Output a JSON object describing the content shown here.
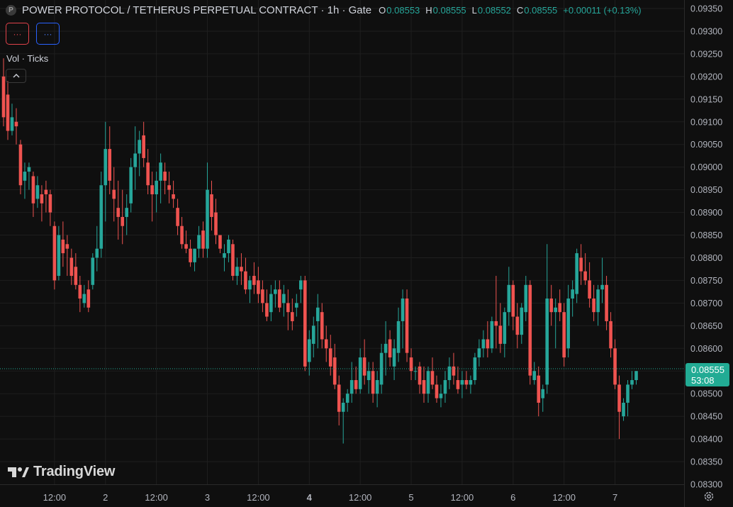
{
  "legend": {
    "logo_letter": "P",
    "title": "POWER PROTOCOL / TETHERUS PERPETUAL CONTRACT · 1h · Gate",
    "open_label": "O",
    "open": "0.08553",
    "high_label": "H",
    "high": "0.08555",
    "low_label": "L",
    "low": "0.08552",
    "close_label": "C",
    "close": "0.08555",
    "change": "+0.00011 (+0.13%)"
  },
  "indicator_buttons": [
    "···",
    "···"
  ],
  "volume_label": "Vol · Ticks",
  "brand": "TradingView",
  "last_price": {
    "price": "0.08555",
    "countdown": "53:08"
  },
  "colors": {
    "up": "#26a69a",
    "down": "#ef5350",
    "background": "#0f0f0f",
    "grid": "#1f1f1f",
    "tag": "#22ab94"
  },
  "chart_data": {
    "type": "candlestick",
    "y_ticks": [
      "0.09350",
      "0.09300",
      "0.09250",
      "0.09200",
      "0.09150",
      "0.09100",
      "0.09050",
      "0.09000",
      "0.08950",
      "0.08900",
      "0.08850",
      "0.08800",
      "0.08750",
      "0.08700",
      "0.08650",
      "0.08600",
      "0.08550",
      "0.08500",
      "0.08450",
      "0.08400",
      "0.08350",
      "0.08300"
    ],
    "ylim": [
      0.083,
      0.0935
    ],
    "x_ticks": [
      {
        "label": "12:00",
        "hour": 12,
        "bold": false
      },
      {
        "label": "2",
        "hour": 24,
        "bold": false
      },
      {
        "label": "12:00",
        "hour": 36,
        "bold": false
      },
      {
        "label": "3",
        "hour": 48,
        "bold": false
      },
      {
        "label": "12:00",
        "hour": 60,
        "bold": false
      },
      {
        "label": "4",
        "hour": 72,
        "bold": true
      },
      {
        "label": "12:00",
        "hour": 84,
        "bold": false
      },
      {
        "label": "5",
        "hour": 96,
        "bold": false
      },
      {
        "label": "12:00",
        "hour": 108,
        "bold": false
      },
      {
        "label": "6",
        "hour": 120,
        "bold": false
      },
      {
        "label": "12:00",
        "hour": 132,
        "bold": false
      },
      {
        "label": "7",
        "hour": 144,
        "bold": false
      }
    ],
    "ohlc": [
      [
        0.092,
        0.0924,
        0.0909,
        0.0911
      ],
      [
        0.0916,
        0.0919,
        0.0906,
        0.0908
      ],
      [
        0.0908,
        0.0914,
        0.0907,
        0.0911
      ],
      [
        0.091,
        0.0913,
        0.0905,
        0.0909
      ],
      [
        0.0905,
        0.0906,
        0.0894,
        0.0896
      ],
      [
        0.0897,
        0.0901,
        0.0893,
        0.0899
      ],
      [
        0.0899,
        0.0901,
        0.0895,
        0.09
      ],
      [
        0.0898,
        0.0899,
        0.0889,
        0.0892
      ],
      [
        0.0893,
        0.0898,
        0.0891,
        0.0896
      ],
      [
        0.0894,
        0.0896,
        0.0888,
        0.0892
      ],
      [
        0.0895,
        0.0897,
        0.089,
        0.0894
      ],
      [
        0.0894,
        0.0895,
        0.0887,
        0.089
      ],
      [
        0.0887,
        0.0888,
        0.0873,
        0.0875
      ],
      [
        0.0876,
        0.0887,
        0.0875,
        0.0885
      ],
      [
        0.0884,
        0.0888,
        0.0878,
        0.0881
      ],
      [
        0.0883,
        0.0885,
        0.0876,
        0.0882
      ],
      [
        0.088,
        0.0882,
        0.0874,
        0.0876
      ],
      [
        0.0878,
        0.0881,
        0.0873,
        0.0874
      ],
      [
        0.0874,
        0.0876,
        0.0868,
        0.0871
      ],
      [
        0.087,
        0.0874,
        0.0869,
        0.0872
      ],
      [
        0.0873,
        0.0875,
        0.0868,
        0.0869
      ],
      [
        0.0874,
        0.0881,
        0.0873,
        0.088
      ],
      [
        0.088,
        0.0887,
        0.0877,
        0.0882
      ],
      [
        0.0882,
        0.0899,
        0.088,
        0.0896
      ],
      [
        0.0896,
        0.091,
        0.0888,
        0.0904
      ],
      [
        0.0904,
        0.0909,
        0.0894,
        0.0897
      ],
      [
        0.0895,
        0.09,
        0.0888,
        0.0893
      ],
      [
        0.0891,
        0.0897,
        0.0884,
        0.0889
      ],
      [
        0.0889,
        0.0895,
        0.0883,
        0.0887
      ],
      [
        0.0889,
        0.0894,
        0.0885,
        0.0891
      ],
      [
        0.0892,
        0.0902,
        0.089,
        0.09
      ],
      [
        0.09,
        0.0909,
        0.0895,
        0.0903
      ],
      [
        0.0903,
        0.0908,
        0.0898,
        0.0906
      ],
      [
        0.0907,
        0.091,
        0.09,
        0.0902
      ],
      [
        0.0901,
        0.0904,
        0.0894,
        0.0896
      ],
      [
        0.0896,
        0.0899,
        0.0888,
        0.0894
      ],
      [
        0.0894,
        0.0899,
        0.089,
        0.0897
      ],
      [
        0.0897,
        0.0903,
        0.0892,
        0.0901
      ],
      [
        0.0899,
        0.0901,
        0.0894,
        0.0897
      ],
      [
        0.0896,
        0.0899,
        0.0892,
        0.0895
      ],
      [
        0.0894,
        0.0897,
        0.0891,
        0.0893
      ],
      [
        0.0891,
        0.0893,
        0.0885,
        0.0887
      ],
      [
        0.0887,
        0.0889,
        0.0882,
        0.0883
      ],
      [
        0.0883,
        0.0886,
        0.0881,
        0.0882
      ],
      [
        0.0882,
        0.0884,
        0.0878,
        0.0879
      ],
      [
        0.0879,
        0.0882,
        0.0877,
        0.0882
      ],
      [
        0.0882,
        0.0887,
        0.088,
        0.0885
      ],
      [
        0.0886,
        0.0888,
        0.088,
        0.0882
      ],
      [
        0.0882,
        0.0901,
        0.088,
        0.0895
      ],
      [
        0.0894,
        0.0897,
        0.0886,
        0.0889
      ],
      [
        0.089,
        0.0893,
        0.0883,
        0.0885
      ],
      [
        0.0885,
        0.0884,
        0.0881,
        0.0882
      ],
      [
        0.088,
        0.0883,
        0.0877,
        0.0881
      ],
      [
        0.0881,
        0.0885,
        0.0879,
        0.0884
      ],
      [
        0.0883,
        0.0884,
        0.0875,
        0.0876
      ],
      [
        0.0876,
        0.088,
        0.0874,
        0.0878
      ],
      [
        0.0878,
        0.0881,
        0.0874,
        0.0877
      ],
      [
        0.0877,
        0.088,
        0.0872,
        0.0873
      ],
      [
        0.0873,
        0.0876,
        0.087,
        0.0875
      ],
      [
        0.0876,
        0.0879,
        0.0872,
        0.0874
      ],
      [
        0.0875,
        0.0878,
        0.087,
        0.0872
      ],
      [
        0.0873,
        0.0875,
        0.0868,
        0.087
      ],
      [
        0.087,
        0.0873,
        0.0866,
        0.0867
      ],
      [
        0.0868,
        0.0874,
        0.0866,
        0.0872
      ],
      [
        0.0872,
        0.0875,
        0.0869,
        0.0873
      ],
      [
        0.0873,
        0.0875,
        0.0868,
        0.0869
      ],
      [
        0.087,
        0.0874,
        0.0867,
        0.0872
      ],
      [
        0.087,
        0.0873,
        0.0864,
        0.0868
      ],
      [
        0.0868,
        0.0871,
        0.0864,
        0.0866
      ],
      [
        0.0869,
        0.0872,
        0.0867,
        0.087
      ],
      [
        0.0873,
        0.0876,
        0.087,
        0.0875
      ],
      [
        0.0875,
        0.0876,
        0.0855,
        0.0856
      ],
      [
        0.0857,
        0.0864,
        0.0854,
        0.0862
      ],
      [
        0.0861,
        0.0867,
        0.0858,
        0.0865
      ],
      [
        0.0866,
        0.0872,
        0.086,
        0.0869
      ],
      [
        0.0868,
        0.087,
        0.086,
        0.0862
      ],
      [
        0.0862,
        0.0865,
        0.0857,
        0.086
      ],
      [
        0.086,
        0.0863,
        0.0854,
        0.0856
      ],
      [
        0.0858,
        0.0861,
        0.0851,
        0.0852
      ],
      [
        0.0852,
        0.0854,
        0.0843,
        0.0846
      ],
      [
        0.0846,
        0.0849,
        0.0839,
        0.0848
      ],
      [
        0.0848,
        0.0851,
        0.0846,
        0.085
      ],
      [
        0.085,
        0.0857,
        0.0848,
        0.0853
      ],
      [
        0.0853,
        0.0856,
        0.085,
        0.0851
      ],
      [
        0.0851,
        0.086,
        0.085,
        0.0858
      ],
      [
        0.0858,
        0.0862,
        0.0852,
        0.0854
      ],
      [
        0.0853,
        0.0857,
        0.085,
        0.0855
      ],
      [
        0.0855,
        0.0857,
        0.0848,
        0.085
      ],
      [
        0.085,
        0.0855,
        0.0847,
        0.0853
      ],
      [
        0.0852,
        0.0861,
        0.085,
        0.0859
      ],
      [
        0.0859,
        0.0866,
        0.0854,
        0.0861
      ],
      [
        0.0862,
        0.0864,
        0.0856,
        0.0858
      ],
      [
        0.0856,
        0.0862,
        0.0853,
        0.086
      ],
      [
        0.0859,
        0.0869,
        0.0857,
        0.0866
      ],
      [
        0.0866,
        0.0873,
        0.086,
        0.0871
      ],
      [
        0.0871,
        0.0873,
        0.0857,
        0.0859
      ],
      [
        0.0858,
        0.086,
        0.0853,
        0.0855
      ],
      [
        0.0855,
        0.0856,
        0.0853,
        0.0855
      ],
      [
        0.0856,
        0.0857,
        0.085,
        0.0852
      ],
      [
        0.0853,
        0.0856,
        0.0848,
        0.085
      ],
      [
        0.085,
        0.0856,
        0.0848,
        0.0855
      ],
      [
        0.0855,
        0.0858,
        0.0851,
        0.0852
      ],
      [
        0.0852,
        0.0854,
        0.0848,
        0.0849
      ],
      [
        0.0849,
        0.0852,
        0.0847,
        0.085
      ],
      [
        0.085,
        0.0855,
        0.0848,
        0.0853
      ],
      [
        0.0853,
        0.0858,
        0.0851,
        0.0856
      ],
      [
        0.0856,
        0.0859,
        0.0852,
        0.0854
      ],
      [
        0.0853,
        0.0856,
        0.085,
        0.0851
      ],
      [
        0.0852,
        0.0855,
        0.0849,
        0.0853
      ],
      [
        0.0853,
        0.0855,
        0.0851,
        0.0852
      ],
      [
        0.0852,
        0.0854,
        0.085,
        0.0853
      ],
      [
        0.0853,
        0.0859,
        0.0852,
        0.0858
      ],
      [
        0.0858,
        0.0862,
        0.0856,
        0.086
      ],
      [
        0.086,
        0.0864,
        0.0858,
        0.0862
      ],
      [
        0.0862,
        0.0866,
        0.0858,
        0.086
      ],
      [
        0.086,
        0.0867,
        0.0859,
        0.0866
      ],
      [
        0.0866,
        0.0876,
        0.086,
        0.0865
      ],
      [
        0.0865,
        0.087,
        0.0859,
        0.0861
      ],
      [
        0.0861,
        0.0869,
        0.0858,
        0.0868
      ],
      [
        0.0868,
        0.0878,
        0.0865,
        0.0874
      ],
      [
        0.0874,
        0.0875,
        0.0864,
        0.0867
      ],
      [
        0.0867,
        0.087,
        0.086,
        0.0863
      ],
      [
        0.0863,
        0.087,
        0.0861,
        0.0869
      ],
      [
        0.0868,
        0.0876,
        0.0866,
        0.0874
      ],
      [
        0.0874,
        0.0875,
        0.0852,
        0.0854
      ],
      [
        0.0853,
        0.0857,
        0.0852,
        0.0855
      ],
      [
        0.0854,
        0.0856,
        0.0845,
        0.0848
      ],
      [
        0.0849,
        0.0852,
        0.0846,
        0.0851
      ],
      [
        0.0852,
        0.0883,
        0.085,
        0.0871
      ],
      [
        0.0871,
        0.0874,
        0.0865,
        0.0868
      ],
      [
        0.0868,
        0.0871,
        0.086,
        0.0869
      ],
      [
        0.087,
        0.0873,
        0.0866,
        0.0868
      ],
      [
        0.0868,
        0.087,
        0.0856,
        0.0858
      ],
      [
        0.086,
        0.0874,
        0.0858,
        0.0871
      ],
      [
        0.0871,
        0.0875,
        0.0867,
        0.0873
      ],
      [
        0.0872,
        0.0882,
        0.087,
        0.0881
      ],
      [
        0.088,
        0.0883,
        0.0874,
        0.0877
      ],
      [
        0.0877,
        0.0881,
        0.0874,
        0.0875
      ],
      [
        0.0875,
        0.0879,
        0.0869,
        0.0871
      ],
      [
        0.0871,
        0.0874,
        0.0866,
        0.0868
      ],
      [
        0.0868,
        0.0874,
        0.0865,
        0.0873
      ],
      [
        0.0873,
        0.088,
        0.087,
        0.0874
      ],
      [
        0.0874,
        0.0876,
        0.0864,
        0.0866
      ],
      [
        0.0866,
        0.0868,
        0.0858,
        0.086
      ],
      [
        0.086,
        0.0862,
        0.0851,
        0.0852
      ],
      [
        0.0852,
        0.0854,
        0.084,
        0.0846
      ],
      [
        0.0845,
        0.0849,
        0.0844,
        0.0848
      ],
      [
        0.0848,
        0.0853,
        0.0845,
        0.0852
      ],
      [
        0.0852,
        0.0855,
        0.0851,
        0.0853
      ],
      [
        0.0853,
        0.0855,
        0.0852,
        0.0855
      ]
    ]
  }
}
